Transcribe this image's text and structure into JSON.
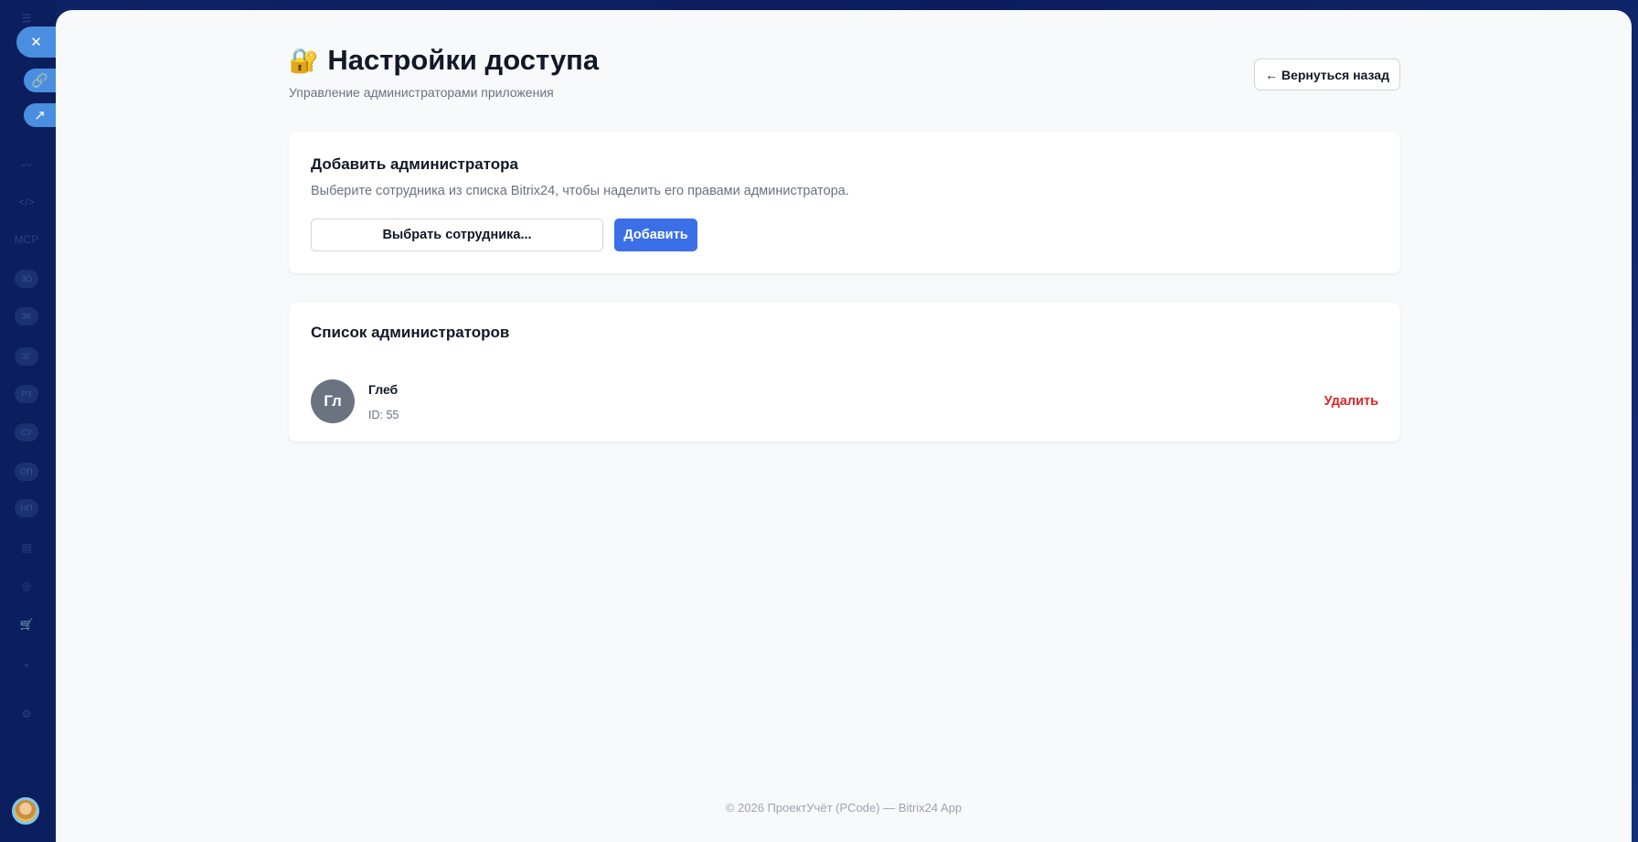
{
  "page": {
    "title": "Настройки доступа",
    "title_icon": "lock-with-key",
    "subtitle": "Управление администраторами приложения",
    "back_label": "← Вернуться назад"
  },
  "add_card": {
    "title": "Добавить администратора",
    "description": "Выберите сотрудника из списка Bitrix24, чтобы наделить его правами администратора.",
    "select_label": "Выбрать сотрудника...",
    "add_label": "Добавить"
  },
  "list_card": {
    "title": "Список администраторов",
    "admins": [
      {
        "initials": "Гл",
        "name": "Глеб",
        "id": "ID: 55",
        "remove_label": "Удалить"
      }
    ]
  },
  "footer": "© 2026 ПроектУчёт (PCode) — Bitrix24 App",
  "sidebar": {
    "badges": [
      "ЗО",
      "ЗК",
      "ЗГ",
      "РЗ",
      "СУ",
      "ОП",
      "НП"
    ],
    "mcp": "MCP"
  },
  "colors": {
    "accent": "#3b6fe8",
    "danger": "#dc2626",
    "sidebar_bg": "#0b1f5e"
  }
}
